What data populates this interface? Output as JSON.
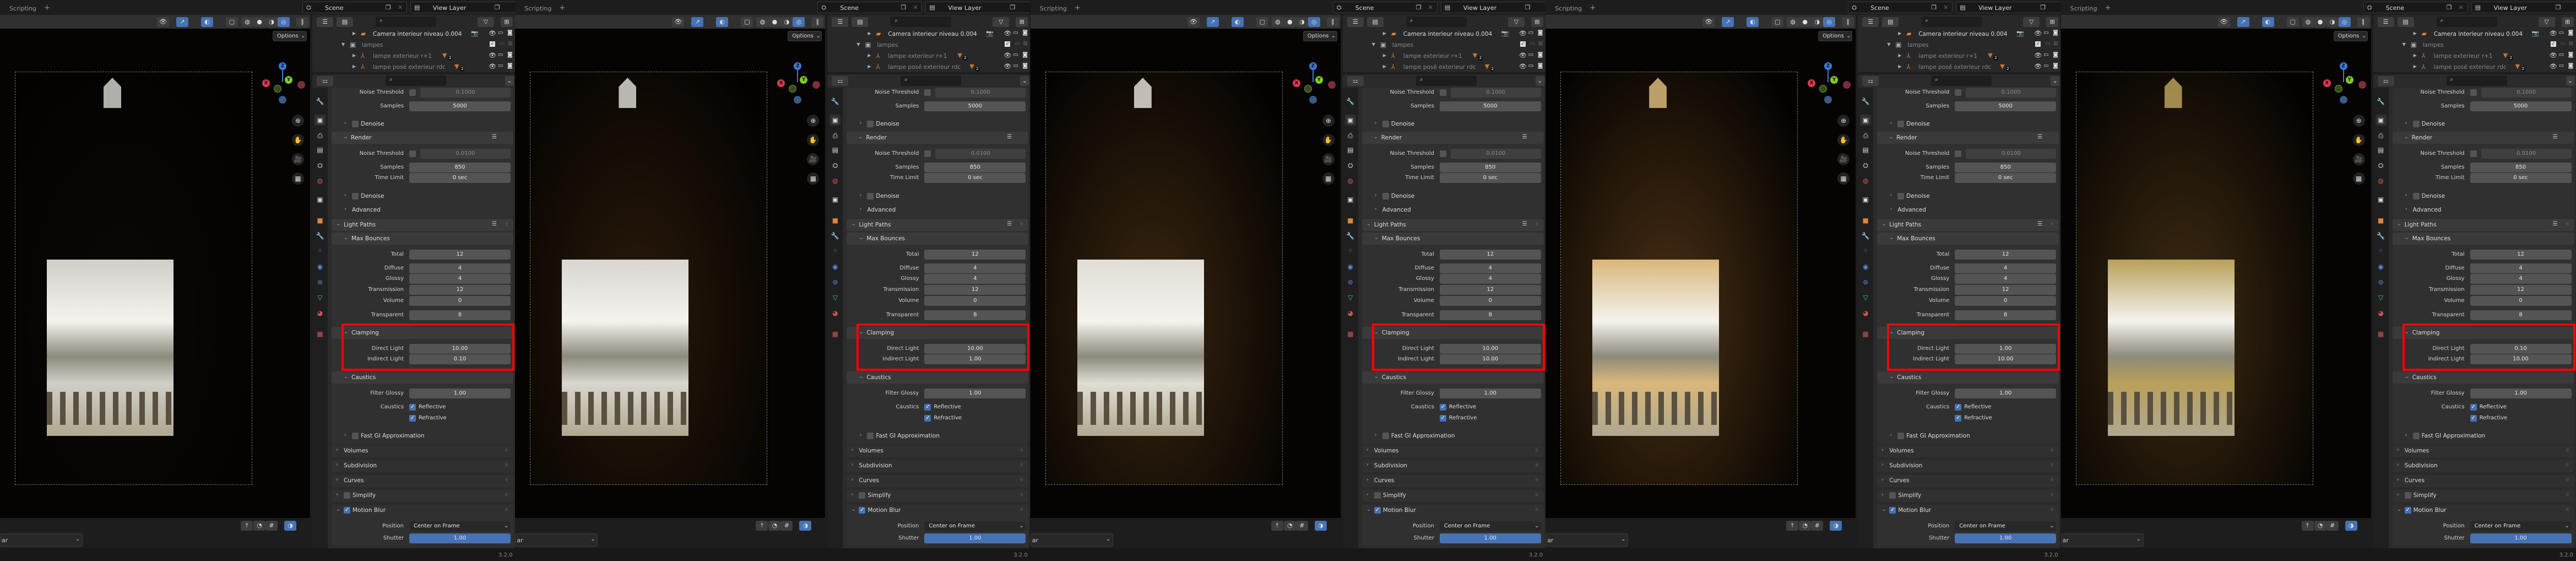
{
  "topbar": {
    "workspace_tab": "Scripting",
    "add_tab": "+",
    "scene": "Scene",
    "view_layer": "View Layer"
  },
  "viewport": {
    "options": "Options",
    "gizmo": {
      "x": "X",
      "y": "Y",
      "z": "Z"
    }
  },
  "outliner": {
    "items": [
      {
        "name": "Camera interieur niveau 0.004",
        "icon": "camera-icon"
      },
      {
        "name": "lampes",
        "icon": "collection-icon"
      },
      {
        "name": "lampe exterieur r+1",
        "icon": "light-object-icon",
        "badge": "2"
      },
      {
        "name": "lampe posé exterieur rdc",
        "icon": "light-object-icon",
        "badge": "2"
      }
    ]
  },
  "properties": {
    "noise_threshold_label": "Noise Threshold",
    "viewport_noise_threshold": "0.1000",
    "samples_label": "Samples",
    "viewport_samples": "5000",
    "denoise": "Denoise",
    "render": "Render",
    "render_noise_threshold": "0.0100",
    "render_samples": "850",
    "time_limit_label": "Time Limit",
    "time_limit": "0 sec",
    "advanced": "Advanced",
    "light_paths": "Light Paths",
    "max_bounces": "Max Bounces",
    "bounces": [
      {
        "label": "Total",
        "value": "12"
      },
      {
        "label": "Diffuse",
        "value": "4"
      },
      {
        "label": "Glossy",
        "value": "4"
      },
      {
        "label": "Transmission",
        "value": "12"
      },
      {
        "label": "Volume",
        "value": "0"
      },
      {
        "label": "Transparent",
        "value": "8"
      }
    ],
    "clamping": "Clamping",
    "direct_light_label": "Direct Light",
    "indirect_light_label": "Indirect Light",
    "caustics_section": "Caustics",
    "filter_glossy_label": "Filter Glossy",
    "filter_glossy": "1.00",
    "caustics_label": "Caustics",
    "reflective": "Reflective",
    "refractive": "Refractive",
    "fast_gi": "Fast GI Approximation",
    "volumes": "Volumes",
    "subdivision": "Subdivision",
    "curves": "Curves",
    "simplify": "Simplify",
    "motion_blur": "Motion Blur",
    "position_label": "Position",
    "position": "Center on Frame",
    "shutter_label": "Shutter",
    "shutter": "1.00"
  },
  "panels": [
    {
      "direct_light": "10.00",
      "indirect_light": "0.10",
      "render_tint": "#0b0805",
      "opening_tint": "#cfcfc8"
    },
    {
      "direct_light": "10.00",
      "indirect_light": "1.00",
      "render_tint": "#2a1a0a",
      "opening_tint": "#d8d6cf"
    },
    {
      "direct_light": "10.00",
      "indirect_light": "10.00",
      "render_tint": "#3a2610",
      "opening_tint": "#e0ddd5"
    },
    {
      "direct_light": "1.00",
      "indirect_light": "10.00",
      "render_tint": "#4a3014",
      "opening_tint": "#d9b77a"
    },
    {
      "direct_light": "0.10",
      "indirect_light": "10.00",
      "render_tint": "#3f2c12",
      "opening_tint": "#b9a05a"
    }
  ],
  "timeline": {
    "dropdown": "ar"
  },
  "status": {
    "version": "3.2.0"
  },
  "colors": {
    "accent": "#4772b3",
    "highlight_box": "#ff0000",
    "panel_bg": "#303030",
    "field_bg": "#545454"
  }
}
